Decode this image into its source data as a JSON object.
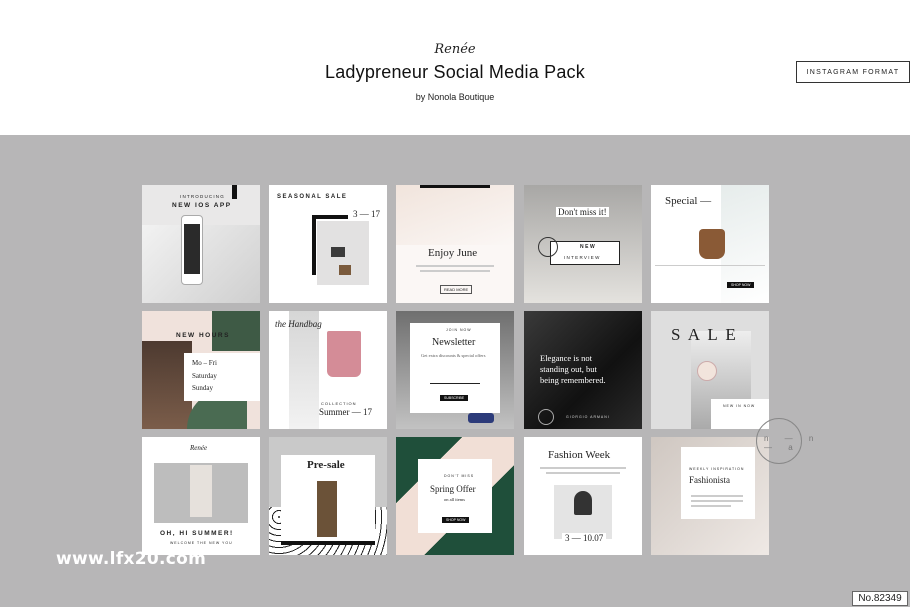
{
  "header": {
    "brand": "Renée",
    "title": "Ladypreneur Social Media Pack",
    "byline": "by Nonola Boutique",
    "format_button": "INSTAGRAM FORMAT"
  },
  "tiles": {
    "t1": {
      "top": "INTRODUCING",
      "title": "NEW IOS APP"
    },
    "t2": {
      "title": "SEASONAL SALE",
      "date": "3 — 17"
    },
    "t3": {
      "title": "Enjoy June",
      "cta": "READ MORE"
    },
    "t4": {
      "title": "Don't miss it!",
      "label": "NEW",
      "sub": "INTERVIEW"
    },
    "t5": {
      "title": "Special —",
      "cta": "SHOP NOW"
    },
    "t6": {
      "title": "NEW HOURS",
      "day1": "Mo – Fri",
      "day2": "Saturday",
      "day3": "Sunday"
    },
    "t7": {
      "script": "the Handbag",
      "label": "COLLECTION",
      "title": "Summer — 17"
    },
    "t8": {
      "top": "JOIN NOW",
      "title": "Newsletter",
      "body": "Get extra discounts & special offers",
      "cta": "SUBSCRIBE"
    },
    "t9": {
      "line1": "Elegance is not",
      "line2": "standing out, but",
      "line3": "being remembered.",
      "author": "GIORGIO ARMANI"
    },
    "t10": {
      "title": "S A L E",
      "label": "NEW IN NOW"
    },
    "t11": {
      "brand": "Renée",
      "title": "OH, HI SUMMER!",
      "sub": "WELCOME THE NEW YOU"
    },
    "t12": {
      "title": "Pre-sale"
    },
    "t13": {
      "top": "DON'T MISS",
      "title": "Spring Offer",
      "sub": "on all items",
      "cta": "SHOP NOW"
    },
    "t14": {
      "title": "Fashion Week",
      "date": "3 — 10.07"
    },
    "t15": {
      "top": "WEEKLY INSPIRATION",
      "title": "Fashionista"
    }
  },
  "watermark": "www.lfx20.com",
  "badge": "No.82349",
  "logo": "n — n — a"
}
